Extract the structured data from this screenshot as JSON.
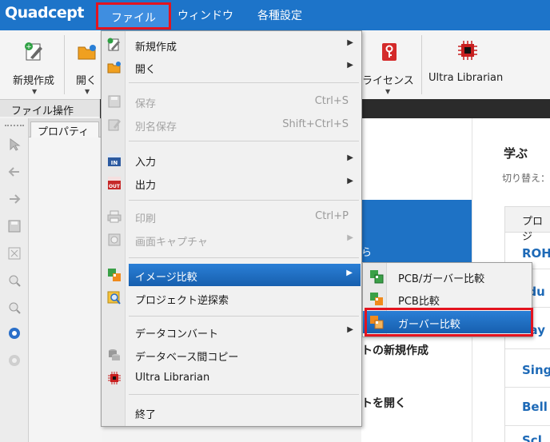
{
  "app": {
    "logo": "Quadcept"
  },
  "menubar": {
    "file": "ファイル",
    "window": "ウィンドウ",
    "various": "各種設定"
  },
  "ribbon": {
    "new_label": "新規作成",
    "open_label": "開く",
    "license_label": "ライセンス",
    "ultra_label": "Ultra Librarian",
    "group_label": "ファイル操作"
  },
  "property_panel": {
    "tab": "プロパティ"
  },
  "file_menu": {
    "items": [
      {
        "label": "新規作成",
        "shortcut": "",
        "icon": "new-document-icon"
      },
      {
        "label": "開く",
        "shortcut": "",
        "icon": "open-folder-icon"
      },
      {
        "label": "保存",
        "shortcut": "Ctrl+S",
        "icon": "save-icon"
      },
      {
        "label": "別名保存",
        "shortcut": "Shift+Ctrl+S",
        "icon": "save-as-icon"
      },
      {
        "label": "入力",
        "shortcut": "",
        "icon": "import-in-icon",
        "icon_text": "IN"
      },
      {
        "label": "出力",
        "shortcut": "",
        "icon": "export-out-icon",
        "icon_text": "OUT"
      },
      {
        "label": "印刷",
        "shortcut": "Ctrl+P",
        "icon": "print-icon"
      },
      {
        "label": "画面キャプチャ",
        "shortcut": "",
        "icon": "capture-icon"
      },
      {
        "label": "イメージ比較",
        "shortcut": "",
        "icon": "image-compare-icon"
      },
      {
        "label": "プロジェクト逆探索",
        "shortcut": "",
        "icon": "reverse-search-icon"
      },
      {
        "label": "データコンバート",
        "shortcut": "",
        "icon": ""
      },
      {
        "label": "データベース間コピー",
        "shortcut": "",
        "icon": "database-copy-icon"
      },
      {
        "label": "Ultra Librarian",
        "shortcut": "",
        "icon": "ultra-librarian-icon"
      },
      {
        "label": "終了",
        "shortcut": "",
        "icon": ""
      }
    ]
  },
  "compare_submenu": {
    "items": [
      {
        "label": "PCB/ガーバー比較",
        "icon": "compare-pcb-gerber-icon"
      },
      {
        "label": "PCB比較",
        "icon": "compare-pcb-icon"
      },
      {
        "label": "ガーバー比較",
        "icon": "compare-gerber-icon"
      }
    ]
  },
  "start_page": {
    "blue_block_text": "ら",
    "item_new": "トの新規作成",
    "item_open": "トを開く",
    "learn_title": "学ぶ",
    "learn_switch": "切り替え：",
    "learn_head": "プロジ",
    "learn_links": [
      "ROH",
      "rdu",
      "Lay",
      "Sing",
      "Bell",
      "Scl"
    ]
  },
  "colors": {
    "titlebar": "#1d74c9",
    "highlight": "#1d6ec5",
    "callout": "#e3141f"
  }
}
